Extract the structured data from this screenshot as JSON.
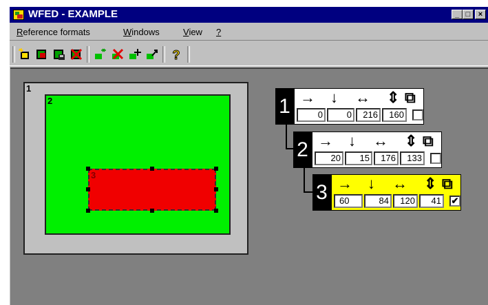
{
  "window": {
    "title": "WFED - EXAMPLE",
    "controls": [
      "_",
      "□",
      "×"
    ]
  },
  "menu": {
    "items": [
      {
        "underline": "R",
        "rest": "eference formats"
      },
      {
        "underline": "W",
        "rest": "indows"
      },
      {
        "underline": "V",
        "rest": "iew"
      },
      {
        "underline": "?",
        "rest": ""
      }
    ]
  },
  "toolbar": {
    "icons": [
      "new-format-icon",
      "open-format-icon",
      "save-format-icon",
      "delete-format-icon",
      "new-window-icon",
      "delete-window-icon",
      "move-window-icon",
      "resize-window-icon",
      "help-icon"
    ]
  },
  "canvas": {
    "frame_labels": [
      "1",
      "2",
      "3"
    ]
  },
  "panels": [
    {
      "num": "1",
      "x": "0",
      "y": "0",
      "w": "216",
      "h": "160",
      "checked": false
    },
    {
      "num": "2",
      "x": "20",
      "y": "15",
      "w": "176",
      "h": "133",
      "checked": false
    },
    {
      "num": "3",
      "x": "60",
      "y": "84",
      "w": "120",
      "h": "41",
      "checked": true
    }
  ],
  "panel_headers": {
    "right": "→",
    "down": "↓",
    "width": "↔",
    "height": "⇕",
    "copy_icon": "⧉",
    "checkmark": "✔"
  },
  "colors": {
    "titlebar": "#000080",
    "frame2": "#00f000",
    "frame3": "#f00000",
    "selected_panel": "#ffff00",
    "workspace": "#808080"
  }
}
